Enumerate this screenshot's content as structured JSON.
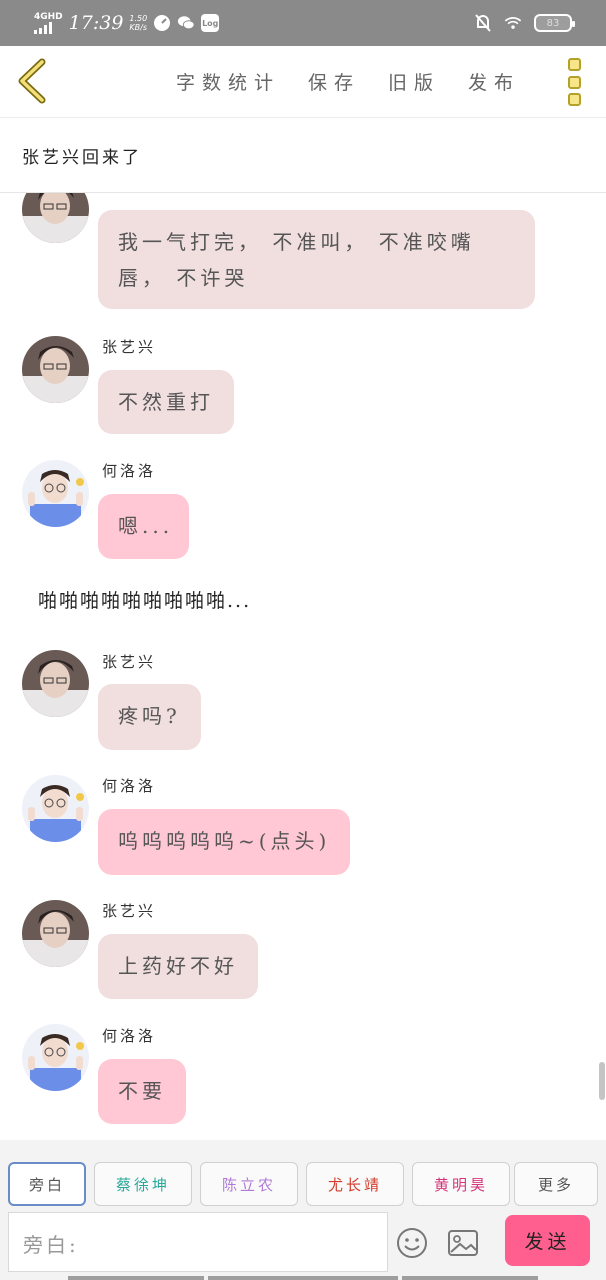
{
  "status_bar": {
    "network": "4GHD",
    "time": "17:39",
    "speed_value": "1.50",
    "speed_unit": "KB/s",
    "log_label": "Log",
    "battery": "83"
  },
  "toolbar": {
    "back_icon": "chevron-left-icon",
    "actions": [
      "字数统计",
      "保存",
      "旧版",
      "发布"
    ],
    "more_icon": "more-vertical-icon"
  },
  "story_title": "张艺兴回来了",
  "messages": [
    {
      "type": "chat",
      "sender": "",
      "text_lines": [
        "我一气打完， 不准叫， 不准咬嘴",
        "唇， 不许哭"
      ],
      "style": "zy"
    },
    {
      "type": "chat",
      "sender": "张艺兴",
      "text_lines": [
        "不然重打"
      ],
      "style": "zy"
    },
    {
      "type": "chat",
      "sender": "何洛洛",
      "text_lines": [
        "嗯..."
      ],
      "style": "hl"
    },
    {
      "type": "narration",
      "text": "啪啪啪啪啪啪啪啪啪..."
    },
    {
      "type": "chat",
      "sender": "张艺兴",
      "text_lines": [
        "疼吗?"
      ],
      "style": "zy"
    },
    {
      "type": "chat",
      "sender": "何洛洛",
      "text_lines": [
        "呜呜呜呜呜~(点头)"
      ],
      "style": "hl"
    },
    {
      "type": "chat",
      "sender": "张艺兴",
      "text_lines": [
        "上药好不好"
      ],
      "style": "zy"
    },
    {
      "type": "chat",
      "sender": "何洛洛",
      "text_lines": [
        "不要"
      ],
      "style": "hl"
    }
  ],
  "characters": [
    {
      "label": "旁白",
      "color": "#555555",
      "active": true
    },
    {
      "label": "蔡徐坤",
      "color": "#2aa89a"
    },
    {
      "label": "陈立农",
      "color": "#b07ad6"
    },
    {
      "label": "尤长靖",
      "color": "#d23a2a"
    },
    {
      "label": "黄明昊",
      "color": "#d6367c"
    },
    {
      "label": "更多",
      "color": "#555555"
    }
  ],
  "input": {
    "placeholder": "旁白:"
  },
  "send_label": "发送",
  "colors": {
    "bubble_zy": "#f1dede",
    "bubble_hl": "#ffc8d4",
    "send": "#ff5f8f",
    "status_bar": "#8a8a8a"
  }
}
